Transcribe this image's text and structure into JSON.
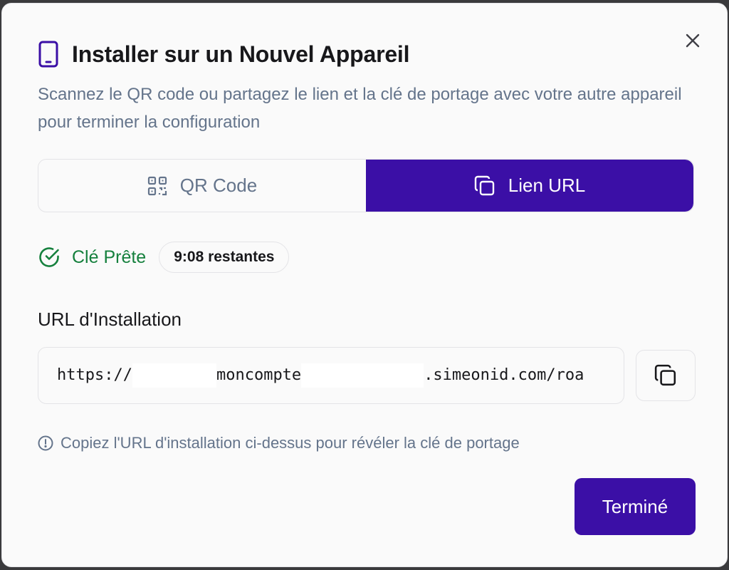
{
  "dialog": {
    "title": "Installer sur un Nouvel Appareil",
    "subtitle": "Scannez le QR code ou partagez le lien et la clé de portage avec votre autre appareil pour terminer la configuration",
    "title_icon": "tablet-icon",
    "close_icon": "close-icon"
  },
  "tabs": [
    {
      "label": "QR Code",
      "icon": "qr-code-icon",
      "active": false
    },
    {
      "label": "Lien URL",
      "icon": "copy-icon",
      "active": true
    }
  ],
  "status": {
    "ready_label": "Clé Prête",
    "ready_icon": "check-circle-icon",
    "timer": "9:08 restantes"
  },
  "install_url": {
    "label": "URL d'Installation",
    "part1": "https://",
    "part2": "moncompte",
    "part3": ".simeonid.com/roa",
    "copy_icon": "copy-icon"
  },
  "hint": {
    "icon": "info-circle-icon",
    "text": "Copiez l'URL d'installation ci-dessus pour révéler la clé de portage"
  },
  "footer": {
    "done_label": "Terminé"
  },
  "colors": {
    "accent": "#3b0fa6",
    "success": "#15803d",
    "muted": "#64748b",
    "text": "#18181b",
    "border": "#e4e4e7"
  }
}
